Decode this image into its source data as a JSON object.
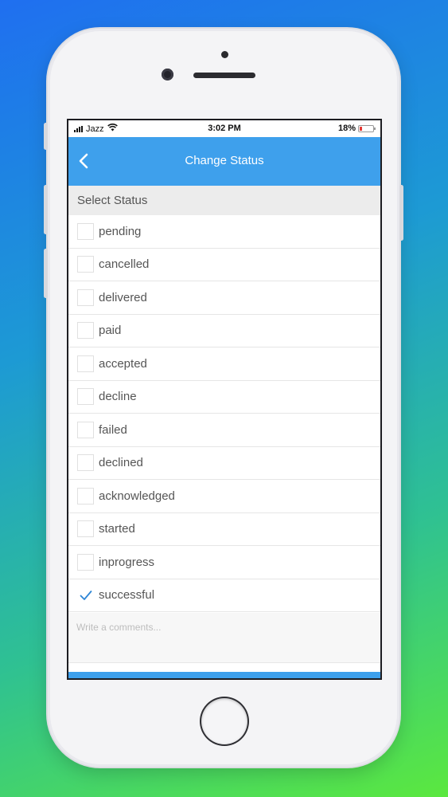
{
  "status_bar": {
    "carrier": "Jazz",
    "time": "3:02 PM",
    "battery": "18%"
  },
  "nav": {
    "title": "Change Status"
  },
  "section": {
    "title": "Select Status"
  },
  "statuses": [
    {
      "label": "pending",
      "checked": false
    },
    {
      "label": "cancelled",
      "checked": false
    },
    {
      "label": "delivered",
      "checked": false
    },
    {
      "label": "paid",
      "checked": false
    },
    {
      "label": "accepted",
      "checked": false
    },
    {
      "label": "decline",
      "checked": false
    },
    {
      "label": "failed",
      "checked": false
    },
    {
      "label": "declined",
      "checked": false
    },
    {
      "label": "acknowledged",
      "checked": false
    },
    {
      "label": "started",
      "checked": false
    },
    {
      "label": "inprogress",
      "checked": false
    },
    {
      "label": "successful",
      "checked": true
    }
  ],
  "comment": {
    "placeholder": "Write a comments...",
    "value": ""
  },
  "colors": {
    "accent": "#3ea0ec",
    "check": "#2e86d6"
  }
}
